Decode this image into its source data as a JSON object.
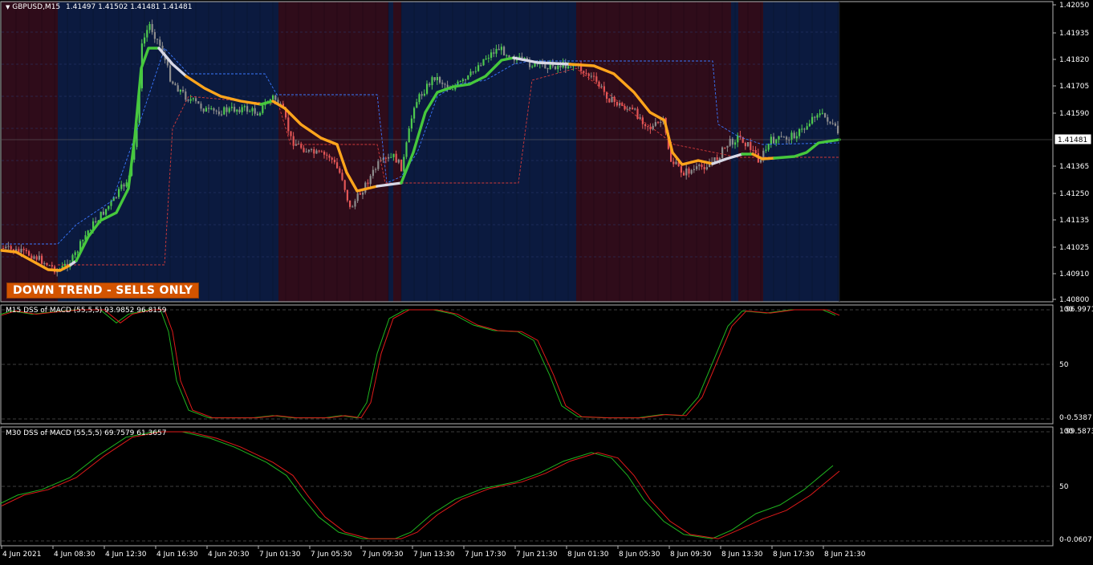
{
  "chart_header": {
    "symbol": "GBPUSD,M15",
    "ohlc": "1.41497 1.41502 1.41481 1.41481",
    "menu_arrow": "triangle-down-icon"
  },
  "trend_badge": "DOWN TREND - SELLS ONLY",
  "price_axis": {
    "ticks": [
      "1.42050",
      "1.41935",
      "1.41820",
      "1.41705",
      "1.41590",
      "1.41365",
      "1.41250",
      "1.41135",
      "1.41025",
      "1.40910",
      "1.40800"
    ],
    "current_price_label": "1.41481"
  },
  "time_axis": {
    "labels": [
      "4 Jun 2021",
      "4 Jun 08:30",
      "4 Jun 12:30",
      "4 Jun 16:30",
      "4 Jun 20:30",
      "7 Jun 01:30",
      "7 Jun 05:30",
      "7 Jun 09:30",
      "7 Jun 13:30",
      "7 Jun 17:30",
      "7 Jun 21:30",
      "8 Jun 01:30",
      "8 Jun 05:30",
      "8 Jun 09:30",
      "8 Jun 13:30",
      "8 Jun 17:30",
      "8 Jun 21:30"
    ]
  },
  "sub1": {
    "title": "M15 DSS of MACD (55,5,5) 93.9852 96.8159",
    "axis_top": "100",
    "axis_top2": "96.9971",
    "axis_mid": "50",
    "axis_bottom": "0",
    "axis_bottom2": "-0.5387"
  },
  "sub2": {
    "title": "M30 DSS of MACD (55,5,5) 69.7579 61.3657",
    "axis_top": "100",
    "axis_top2": "99.5873",
    "axis_mid": "50",
    "axis_bottom": "0",
    "axis_bottom2": "-0.0607"
  },
  "colors": {
    "background": "#000000",
    "bull_zone": "#0b1a3f",
    "bear_zone": "#2f0c1a",
    "bull_candle": "#4ec94e",
    "bear_candle": "#e35656",
    "neutral_candle": "#8c8c8c",
    "ma_up": "#46c83c",
    "ma_down": "#ffa51c",
    "ma_flat": "#d8d8e6",
    "dss_signal": "#1fb41f",
    "dss_main": "#e01a1a"
  }
}
